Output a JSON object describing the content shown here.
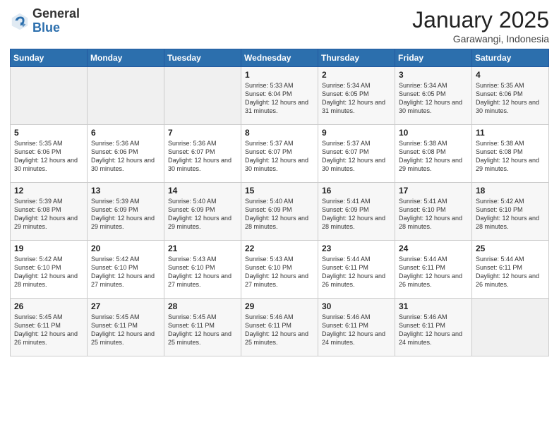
{
  "header": {
    "logo_general": "General",
    "logo_blue": "Blue",
    "month": "January 2025",
    "location": "Garawangi, Indonesia"
  },
  "days_of_week": [
    "Sunday",
    "Monday",
    "Tuesday",
    "Wednesday",
    "Thursday",
    "Friday",
    "Saturday"
  ],
  "weeks": [
    [
      {
        "day": "",
        "info": ""
      },
      {
        "day": "",
        "info": ""
      },
      {
        "day": "",
        "info": ""
      },
      {
        "day": "1",
        "info": "Sunrise: 5:33 AM\nSunset: 6:04 PM\nDaylight: 12 hours and 31 minutes."
      },
      {
        "day": "2",
        "info": "Sunrise: 5:34 AM\nSunset: 6:05 PM\nDaylight: 12 hours and 31 minutes."
      },
      {
        "day": "3",
        "info": "Sunrise: 5:34 AM\nSunset: 6:05 PM\nDaylight: 12 hours and 30 minutes."
      },
      {
        "day": "4",
        "info": "Sunrise: 5:35 AM\nSunset: 6:06 PM\nDaylight: 12 hours and 30 minutes."
      }
    ],
    [
      {
        "day": "5",
        "info": "Sunrise: 5:35 AM\nSunset: 6:06 PM\nDaylight: 12 hours and 30 minutes."
      },
      {
        "day": "6",
        "info": "Sunrise: 5:36 AM\nSunset: 6:06 PM\nDaylight: 12 hours and 30 minutes."
      },
      {
        "day": "7",
        "info": "Sunrise: 5:36 AM\nSunset: 6:07 PM\nDaylight: 12 hours and 30 minutes."
      },
      {
        "day": "8",
        "info": "Sunrise: 5:37 AM\nSunset: 6:07 PM\nDaylight: 12 hours and 30 minutes."
      },
      {
        "day": "9",
        "info": "Sunrise: 5:37 AM\nSunset: 6:07 PM\nDaylight: 12 hours and 30 minutes."
      },
      {
        "day": "10",
        "info": "Sunrise: 5:38 AM\nSunset: 6:08 PM\nDaylight: 12 hours and 29 minutes."
      },
      {
        "day": "11",
        "info": "Sunrise: 5:38 AM\nSunset: 6:08 PM\nDaylight: 12 hours and 29 minutes."
      }
    ],
    [
      {
        "day": "12",
        "info": "Sunrise: 5:39 AM\nSunset: 6:08 PM\nDaylight: 12 hours and 29 minutes."
      },
      {
        "day": "13",
        "info": "Sunrise: 5:39 AM\nSunset: 6:09 PM\nDaylight: 12 hours and 29 minutes."
      },
      {
        "day": "14",
        "info": "Sunrise: 5:40 AM\nSunset: 6:09 PM\nDaylight: 12 hours and 29 minutes."
      },
      {
        "day": "15",
        "info": "Sunrise: 5:40 AM\nSunset: 6:09 PM\nDaylight: 12 hours and 28 minutes."
      },
      {
        "day": "16",
        "info": "Sunrise: 5:41 AM\nSunset: 6:09 PM\nDaylight: 12 hours and 28 minutes."
      },
      {
        "day": "17",
        "info": "Sunrise: 5:41 AM\nSunset: 6:10 PM\nDaylight: 12 hours and 28 minutes."
      },
      {
        "day": "18",
        "info": "Sunrise: 5:42 AM\nSunset: 6:10 PM\nDaylight: 12 hours and 28 minutes."
      }
    ],
    [
      {
        "day": "19",
        "info": "Sunrise: 5:42 AM\nSunset: 6:10 PM\nDaylight: 12 hours and 28 minutes."
      },
      {
        "day": "20",
        "info": "Sunrise: 5:42 AM\nSunset: 6:10 PM\nDaylight: 12 hours and 27 minutes."
      },
      {
        "day": "21",
        "info": "Sunrise: 5:43 AM\nSunset: 6:10 PM\nDaylight: 12 hours and 27 minutes."
      },
      {
        "day": "22",
        "info": "Sunrise: 5:43 AM\nSunset: 6:10 PM\nDaylight: 12 hours and 27 minutes."
      },
      {
        "day": "23",
        "info": "Sunrise: 5:44 AM\nSunset: 6:11 PM\nDaylight: 12 hours and 26 minutes."
      },
      {
        "day": "24",
        "info": "Sunrise: 5:44 AM\nSunset: 6:11 PM\nDaylight: 12 hours and 26 minutes."
      },
      {
        "day": "25",
        "info": "Sunrise: 5:44 AM\nSunset: 6:11 PM\nDaylight: 12 hours and 26 minutes."
      }
    ],
    [
      {
        "day": "26",
        "info": "Sunrise: 5:45 AM\nSunset: 6:11 PM\nDaylight: 12 hours and 26 minutes."
      },
      {
        "day": "27",
        "info": "Sunrise: 5:45 AM\nSunset: 6:11 PM\nDaylight: 12 hours and 25 minutes."
      },
      {
        "day": "28",
        "info": "Sunrise: 5:45 AM\nSunset: 6:11 PM\nDaylight: 12 hours and 25 minutes."
      },
      {
        "day": "29",
        "info": "Sunrise: 5:46 AM\nSunset: 6:11 PM\nDaylight: 12 hours and 25 minutes."
      },
      {
        "day": "30",
        "info": "Sunrise: 5:46 AM\nSunset: 6:11 PM\nDaylight: 12 hours and 24 minutes."
      },
      {
        "day": "31",
        "info": "Sunrise: 5:46 AM\nSunset: 6:11 PM\nDaylight: 12 hours and 24 minutes."
      },
      {
        "day": "",
        "info": ""
      }
    ]
  ]
}
